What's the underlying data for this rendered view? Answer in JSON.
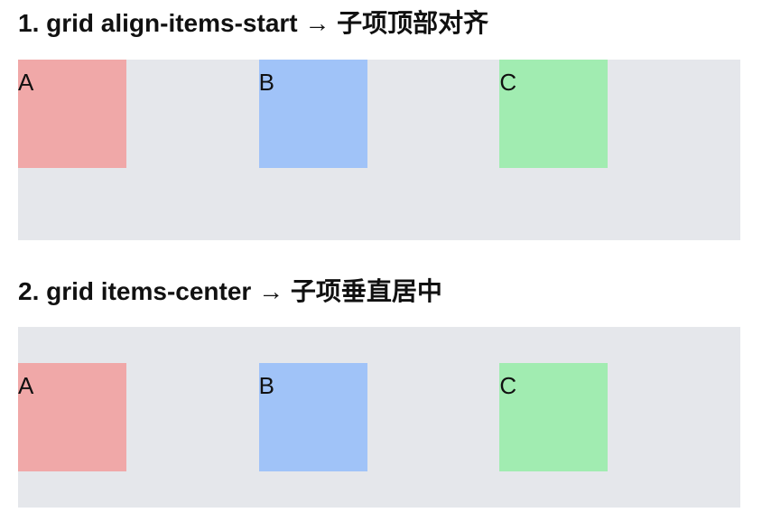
{
  "sections": [
    {
      "title": "1. grid align-items-start → 子项顶部对齐",
      "items": [
        {
          "label": "A",
          "color": "#f0a8a8"
        },
        {
          "label": "B",
          "color": "#a0c3f8"
        },
        {
          "label": "C",
          "color": "#a1ecb1"
        }
      ]
    },
    {
      "title": "2. grid items-center → 子项垂直居中",
      "items": [
        {
          "label": "A",
          "color": "#f0a8a8"
        },
        {
          "label": "B",
          "color": "#a0c3f8"
        },
        {
          "label": "C",
          "color": "#a1ecb1"
        }
      ]
    }
  ],
  "container_color": "#e5e7eb"
}
